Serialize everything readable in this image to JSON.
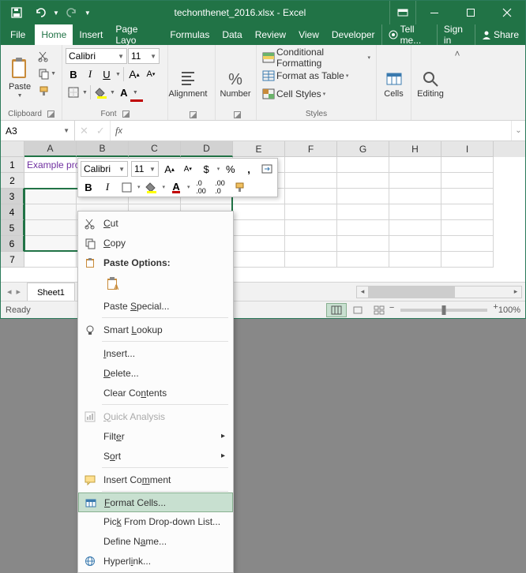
{
  "title": "techonthenet_2016.xlsx - Excel",
  "menu": {
    "file": "File",
    "home": "Home",
    "insert": "Insert",
    "layout": "Page Layo",
    "formulas": "Formulas",
    "data": "Data",
    "review": "Review",
    "view": "View",
    "developer": "Developer",
    "tell": "Tell me...",
    "signin": "Sign in",
    "share": "Share"
  },
  "ribbon": {
    "clipboard": "Clipboard",
    "paste": "Paste",
    "font_group": "Font",
    "font_name": "Calibri",
    "font_size": "11",
    "alignment": "Alignment",
    "number": "Number",
    "styles_group": "Styles",
    "cond": "Conditional Formatting",
    "table": "Format as Table",
    "styles": "Cell Styles",
    "cells": "Cells",
    "editing": "Editing"
  },
  "namebox": "A3",
  "columns": [
    "A",
    "B",
    "C",
    "D",
    "E",
    "F",
    "G",
    "H",
    "I"
  ],
  "rows": [
    "1",
    "2",
    "3",
    "4",
    "5",
    "6",
    "7"
  ],
  "a1": "Example products for testing",
  "sheet": "Sheet1",
  "status": "Ready",
  "zoom": "100%",
  "mini": {
    "font": "Calibri",
    "size": "11"
  },
  "ctx": {
    "cut": "Cut",
    "copy": "Copy",
    "paste_opts": "Paste Options:",
    "paste_special": "Paste Special...",
    "smart": "Smart Lookup",
    "insert": "Insert...",
    "delete": "Delete...",
    "clear": "Clear Contents",
    "quick": "Quick Analysis",
    "filter": "Filter",
    "sort": "Sort",
    "comment": "Insert Comment",
    "format": "Format Cells...",
    "pick": "Pick From Drop-down List...",
    "define": "Define Name...",
    "link": "Hyperlink..."
  }
}
